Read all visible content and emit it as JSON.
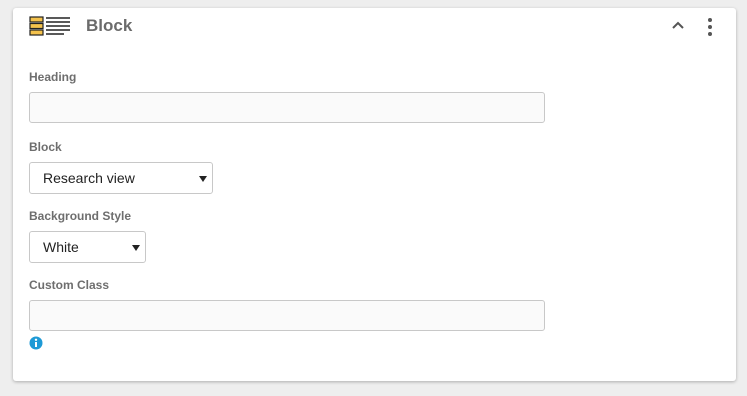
{
  "panel": {
    "title": "Block",
    "icon": "block-list-icon",
    "collapse_icon": "chevron-up-icon",
    "menu_icon": "more-vertical-icon"
  },
  "fields": {
    "heading": {
      "label": "Heading",
      "value": "",
      "placeholder": ""
    },
    "block": {
      "label": "Block",
      "selected": "Research view"
    },
    "background_style": {
      "label": "Background Style",
      "selected": "White"
    },
    "custom_class": {
      "label": "Custom Class",
      "value": "",
      "placeholder": "",
      "help_icon": "info-icon"
    }
  },
  "colors": {
    "icon_accent": "#f4c24c",
    "info": "#1e9ad6",
    "label": "#6e6e6e"
  }
}
